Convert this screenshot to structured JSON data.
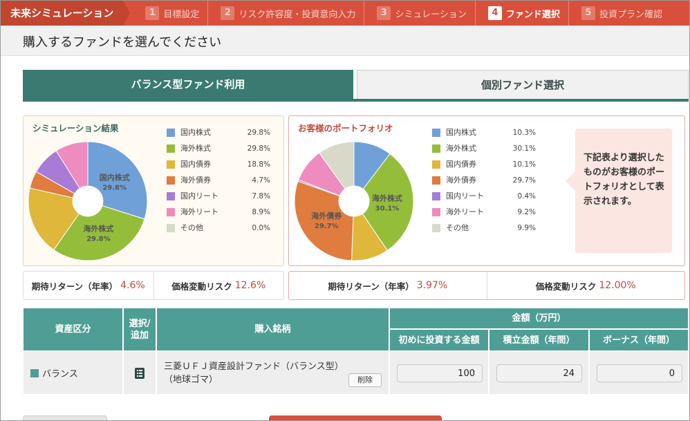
{
  "app_title": "未来シミュレーション",
  "steps": [
    {
      "num": "1",
      "label": "目標設定"
    },
    {
      "num": "2",
      "label": "リスク許容度・投資意向入力"
    },
    {
      "num": "3",
      "label": "シミュレーション"
    },
    {
      "num": "4",
      "label": "ファンド選択"
    },
    {
      "num": "5",
      "label": "投資プラン確認"
    }
  ],
  "active_step": 4,
  "page_title": "購入するファンドを選んでください",
  "tabs": [
    {
      "label": "バランス型ファンド利用",
      "active": true
    },
    {
      "label": "個別ファンド選択",
      "active": false
    }
  ],
  "simulation": {
    "title": "シミュレーション結果",
    "legend": [
      {
        "label": "国内株式",
        "pct": "29.8%",
        "color": "#6fa0d8"
      },
      {
        "label": "海外株式",
        "pct": "29.8%",
        "color": "#94be3a"
      },
      {
        "label": "国内債券",
        "pct": "18.8%",
        "color": "#dfb73a"
      },
      {
        "label": "海外債券",
        "pct": "4.7%",
        "color": "#e07c3e"
      },
      {
        "label": "国内リート",
        "pct": "7.8%",
        "color": "#a87bd6"
      },
      {
        "label": "海外リート",
        "pct": "8.9%",
        "color": "#ee8bbf"
      },
      {
        "label": "その他",
        "pct": "0.0%",
        "color": "#d8d9c8"
      }
    ],
    "slices": [
      29.8,
      29.8,
      18.8,
      4.7,
      7.8,
      8.9,
      0.0
    ],
    "pie_labels": [
      {
        "name": "国内株式",
        "value": "29.8%"
      },
      {
        "name": "海外株式",
        "value": "29.8%"
      }
    ]
  },
  "portfolio": {
    "title": "お客様のポートフォリオ",
    "legend": [
      {
        "label": "国内株式",
        "pct": "10.3%",
        "color": "#6fa0d8"
      },
      {
        "label": "海外株式",
        "pct": "30.1%",
        "color": "#94be3a"
      },
      {
        "label": "国内債券",
        "pct": "10.1%",
        "color": "#dfb73a"
      },
      {
        "label": "海外債券",
        "pct": "29.7%",
        "color": "#e07c3e"
      },
      {
        "label": "国内リート",
        "pct": "0.4%",
        "color": "#a87bd6"
      },
      {
        "label": "海外リート",
        "pct": "9.2%",
        "color": "#ee8bbf"
      },
      {
        "label": "その他",
        "pct": "9.9%",
        "color": "#d8d9c8"
      }
    ],
    "slices": [
      10.3,
      30.1,
      10.1,
      29.7,
      0.4,
      9.2,
      9.9
    ],
    "pie_labels": [
      {
        "name": "海外株式",
        "value": "30.1%"
      },
      {
        "name": "海外債券",
        "value": "29.7%"
      }
    ],
    "callout": "下記表より選択したものがお客様のポートフォリオとして表示されます。"
  },
  "metrics_left": {
    "return_label": "期待リターン（年率）",
    "return_value": "4.6%",
    "risk_label": "価格変動リスク",
    "risk_value": "12.6%"
  },
  "metrics_right": {
    "return_label": "期待リターン（年率）",
    "return_value": "3.97%",
    "risk_label": "価格変動リスク",
    "risk_value": "12.00%"
  },
  "table": {
    "headers": {
      "asset_class": "資産区分",
      "select": "選択/\n追加",
      "fund": "購入銘柄",
      "amount": "金額（万円）",
      "initial": "初めに投資する金額",
      "saving": "積立金額（年間）",
      "bonus": "ボーナス（年間）"
    },
    "row": {
      "asset_class": "バランス",
      "asset_color": "#4f9e96",
      "fund_name": "三菱ＵＦＪ資産設計ファンド（バランス型）（地球ゴマ）",
      "delete_label": "削除",
      "initial": "100",
      "saving": "24",
      "bonus": "0"
    }
  }
}
